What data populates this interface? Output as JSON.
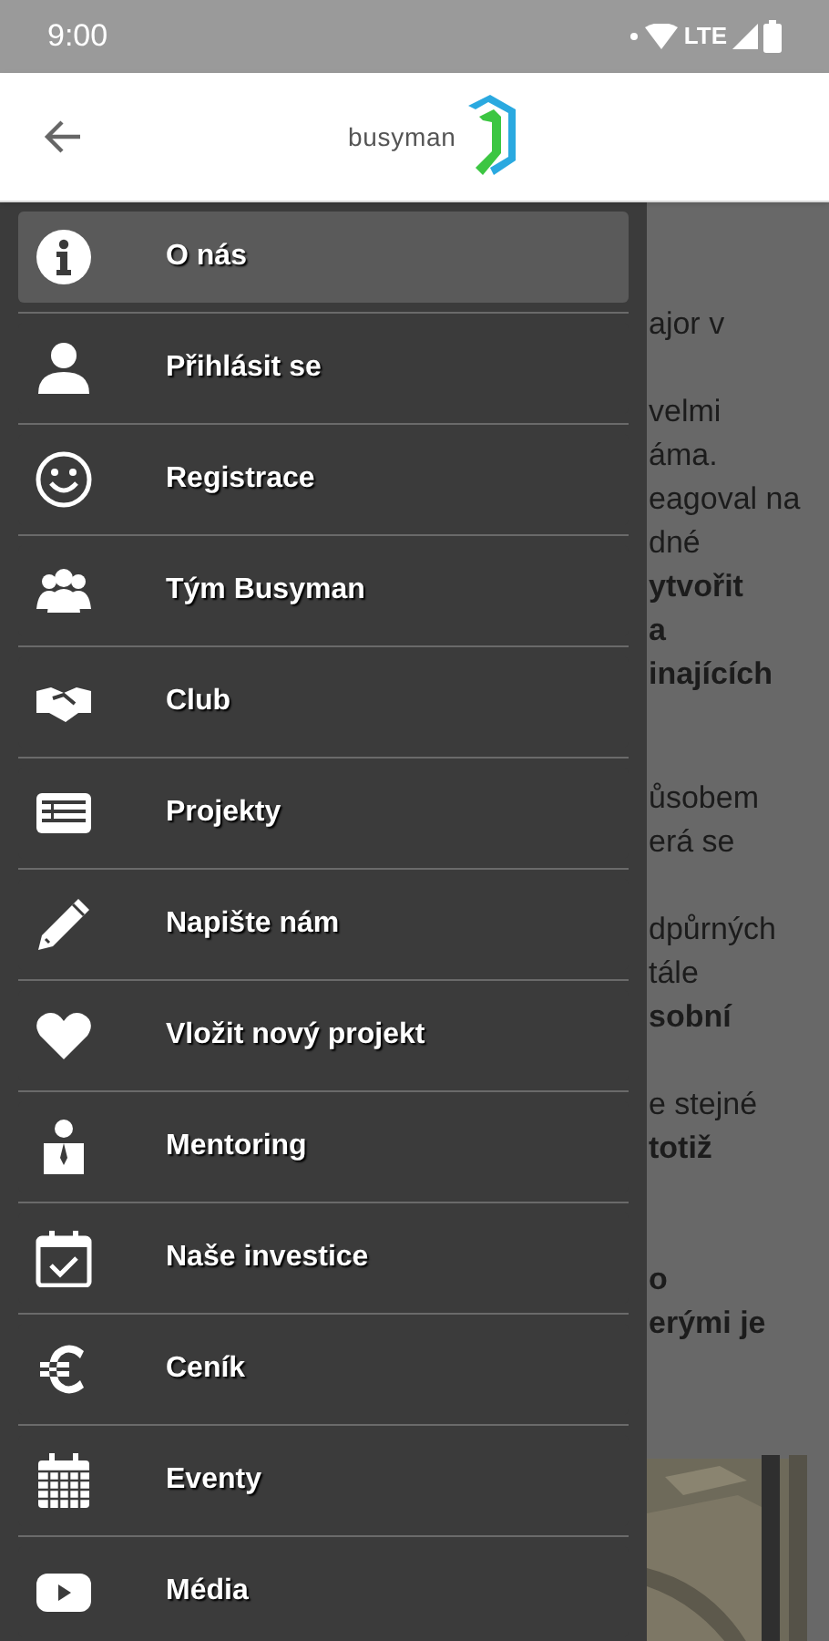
{
  "status_bar": {
    "time": "9:00",
    "network": "LTE"
  },
  "app_bar": {
    "logo_text": "busyman"
  },
  "article_fragments": [
    {
      "text": "ajor v",
      "bold": false
    },
    {
      "text": "velmi",
      "bold": false
    },
    {
      "text": "áma.",
      "bold": false
    },
    {
      "text": "eagoval na",
      "bold": false
    },
    {
      "text": "dné",
      "bold": false
    },
    {
      "text": "ytvořit",
      "bold": true
    },
    {
      "text": "a",
      "bold": true
    },
    {
      "text": "inajících",
      "bold": true
    },
    {
      "text": "ůsobem",
      "bold": false
    },
    {
      "text": "erá se",
      "bold": false
    },
    {
      "text": "dpůrných",
      "bold": false
    },
    {
      "text": "tále",
      "bold": false
    },
    {
      "text": "sobní",
      "bold": true
    },
    {
      "text": "e stejné",
      "bold": false
    },
    {
      "text": "totiž",
      "bold": true
    },
    {
      "text": "o",
      "bold": true
    },
    {
      "text": "erými je",
      "bold": true
    }
  ],
  "drawer": {
    "items": [
      {
        "label": "O nás",
        "selected": true
      },
      {
        "label": "Přihlásit se",
        "selected": false
      },
      {
        "label": "Registrace",
        "selected": false
      },
      {
        "label": "Tým Busyman",
        "selected": false
      },
      {
        "label": "Club",
        "selected": false
      },
      {
        "label": "Projekty",
        "selected": false
      },
      {
        "label": "Napište nám",
        "selected": false
      },
      {
        "label": "Vložit nový projekt",
        "selected": false
      },
      {
        "label": "Mentoring",
        "selected": false
      },
      {
        "label": "Naše investice",
        "selected": false
      },
      {
        "label": "Ceník",
        "selected": false
      },
      {
        "label": "Eventy",
        "selected": false
      },
      {
        "label": "Média",
        "selected": false
      }
    ]
  }
}
